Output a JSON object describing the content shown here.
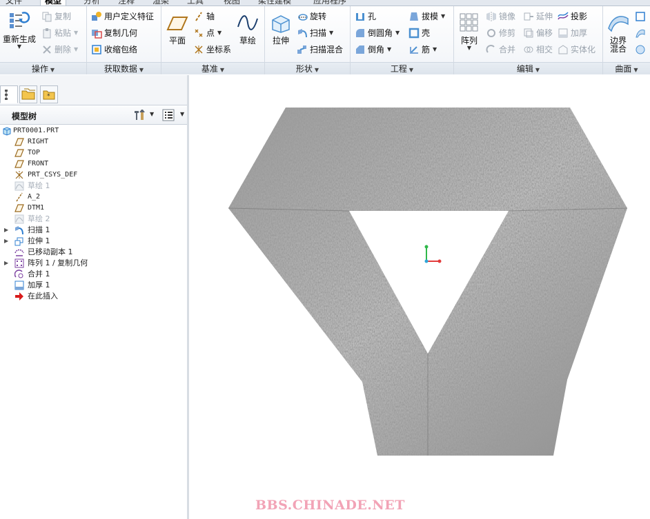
{
  "menu_tabs": [
    "文件",
    "模型",
    "分析",
    "注释",
    "渲染",
    "工具",
    "视图",
    "柔性建模",
    "应用程序"
  ],
  "ribbon": {
    "operations": {
      "label": "操作",
      "regenerate": "重新生成",
      "copy": "复制",
      "paste": "粘贴",
      "delete": "删除"
    },
    "get_data": {
      "label": "获取数据",
      "udf": "用户定义特征",
      "copy_geom": "复制几何",
      "shrinkwrap": "收缩包络"
    },
    "datum": {
      "label": "基准",
      "plane": "平面",
      "axis": "轴",
      "point": "点",
      "csys": "坐标系",
      "sketch": "草绘"
    },
    "shapes": {
      "label": "形状",
      "extrude": "拉伸",
      "revolve": "旋转",
      "sweep": "扫描",
      "swept_blend": "扫描混合"
    },
    "engineering": {
      "label": "工程",
      "hole": "孔",
      "round": "倒圆角",
      "chamfer": "倒角",
      "draft": "拔模",
      "shell": "壳",
      "rib": "筋"
    },
    "editing": {
      "label": "编辑",
      "pattern": "阵列",
      "mirror": "镜像",
      "trim": "修剪",
      "merge": "合并",
      "extend": "延伸",
      "offset": "偏移",
      "intersect": "相交",
      "project": "投影",
      "thicken": "加厚",
      "solidify": "实体化"
    },
    "surfaces": {
      "label": "曲面",
      "boundary_blend": "边界\n混合"
    }
  },
  "model_tree": {
    "title": "模型树",
    "items": [
      {
        "label": "PRT0001.PRT",
        "icon": "part-icon",
        "expandable": false,
        "dim": false,
        "root": true
      },
      {
        "label": "RIGHT",
        "icon": "datum-plane-icon",
        "expandable": false,
        "dim": false
      },
      {
        "label": "TOP",
        "icon": "datum-plane-icon",
        "expandable": false,
        "dim": false
      },
      {
        "label": "FRONT",
        "icon": "datum-plane-icon",
        "expandable": false,
        "dim": false
      },
      {
        "label": "PRT_CSYS_DEF",
        "icon": "csys-icon",
        "expandable": false,
        "dim": false
      },
      {
        "label": "草绘 1",
        "icon": "sketch-icon",
        "expandable": false,
        "dim": true
      },
      {
        "label": "A_2",
        "icon": "axis-icon",
        "expandable": false,
        "dim": false
      },
      {
        "label": "DTM1",
        "icon": "datum-plane-icon",
        "expandable": false,
        "dim": false
      },
      {
        "label": "草绘 2",
        "icon": "sketch-icon",
        "expandable": false,
        "dim": true
      },
      {
        "label": "扫描 1",
        "icon": "sweep-icon",
        "expandable": true,
        "dim": false
      },
      {
        "label": "拉伸 1",
        "icon": "extrude-icon",
        "expandable": true,
        "dim": false
      },
      {
        "label": "已移动副本 1",
        "icon": "moved-copy-icon",
        "expandable": false,
        "dim": false
      },
      {
        "label": "阵列 1 / 复制几何",
        "icon": "pattern-icon",
        "expandable": true,
        "dim": false
      },
      {
        "label": "合并 1",
        "icon": "merge-icon",
        "expandable": false,
        "dim": false
      },
      {
        "label": "加厚 1",
        "icon": "thicken-icon",
        "expandable": false,
        "dim": false
      },
      {
        "label": "在此插入",
        "icon": "insert-here-arrow-icon",
        "expandable": false,
        "dim": false
      }
    ]
  },
  "watermark": "BBS.CHINADE.NET",
  "colors": {
    "accent_blue": "#2f7fd1",
    "csys_x": "#e23b3b",
    "csys_y": "#2fb84a",
    "csys_z": "#2ea6d8",
    "insert_arrow": "#d81b1b",
    "watermark": "#f2a3b6"
  }
}
